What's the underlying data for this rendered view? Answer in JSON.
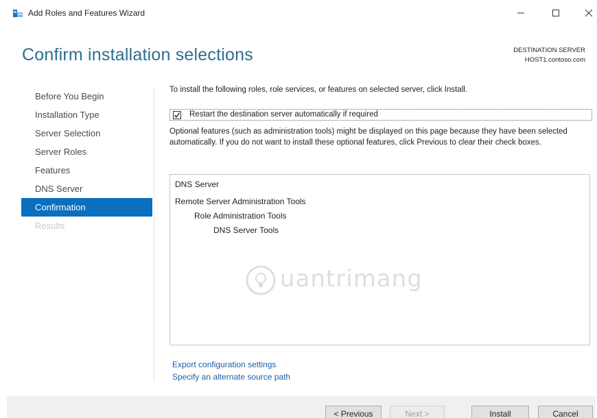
{
  "window": {
    "title": "Add Roles and Features Wizard"
  },
  "header": {
    "page_title": "Confirm installation selections",
    "destination_label": "DESTINATION SERVER",
    "destination_server": "HOST1.contoso.com"
  },
  "nav": {
    "items": [
      {
        "label": "Before You Begin"
      },
      {
        "label": "Installation Type"
      },
      {
        "label": "Server Selection"
      },
      {
        "label": "Server Roles"
      },
      {
        "label": "Features"
      },
      {
        "label": "DNS Server"
      },
      {
        "label": "Confirmation"
      },
      {
        "label": "Results"
      }
    ]
  },
  "content": {
    "intro": "To install the following roles, role services, or features on selected server, click Install.",
    "restart_label": "Restart the destination server automatically if required",
    "restart_checked": true,
    "optional_text": "Optional features (such as administration tools) might be displayed on this page because they have been selected automatically. If you do not want to install these optional features, click Previous to clear their check boxes.",
    "selections": [
      {
        "label": "DNS Server"
      },
      {
        "label": "Remote Server Administration Tools"
      },
      {
        "label": "Role Administration Tools"
      },
      {
        "label": "DNS Server Tools"
      }
    ],
    "watermark": "uantrimang",
    "links": {
      "export": "Export configuration settings",
      "alternate_source": "Specify an alternate source path"
    }
  },
  "footer": {
    "previous": "< Previous",
    "next": "Next >",
    "install": "Install",
    "cancel": "Cancel"
  },
  "colors": {
    "accent": "#0b6fbf",
    "title": "#2e6e8f",
    "link": "#1b5fa8"
  }
}
